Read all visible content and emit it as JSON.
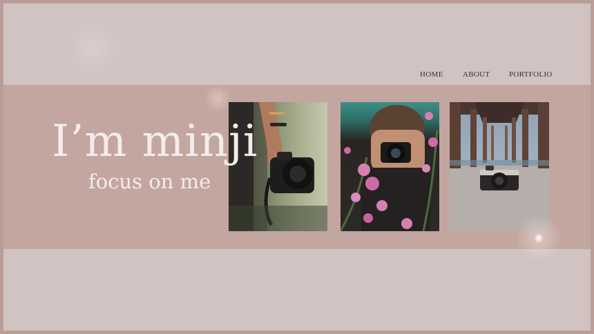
{
  "nav": {
    "items": [
      {
        "label": "HOME"
      },
      {
        "label": "ABOUT"
      },
      {
        "label": "PORTFOLIO"
      }
    ]
  },
  "hero": {
    "title": "I’m minji",
    "subtitle": "focus on me"
  },
  "gallery": {
    "images": [
      {
        "name": "person-holding-camera-photo"
      },
      {
        "name": "photographer-behind-pink-flowers-photo"
      },
      {
        "name": "camera-under-pier-photo"
      }
    ]
  },
  "colors": {
    "background": "#d0c3c1",
    "band": "#c3a6a0",
    "border": "#b99e98",
    "text_light": "#f3ecea",
    "nav_text": "#3a302e"
  }
}
